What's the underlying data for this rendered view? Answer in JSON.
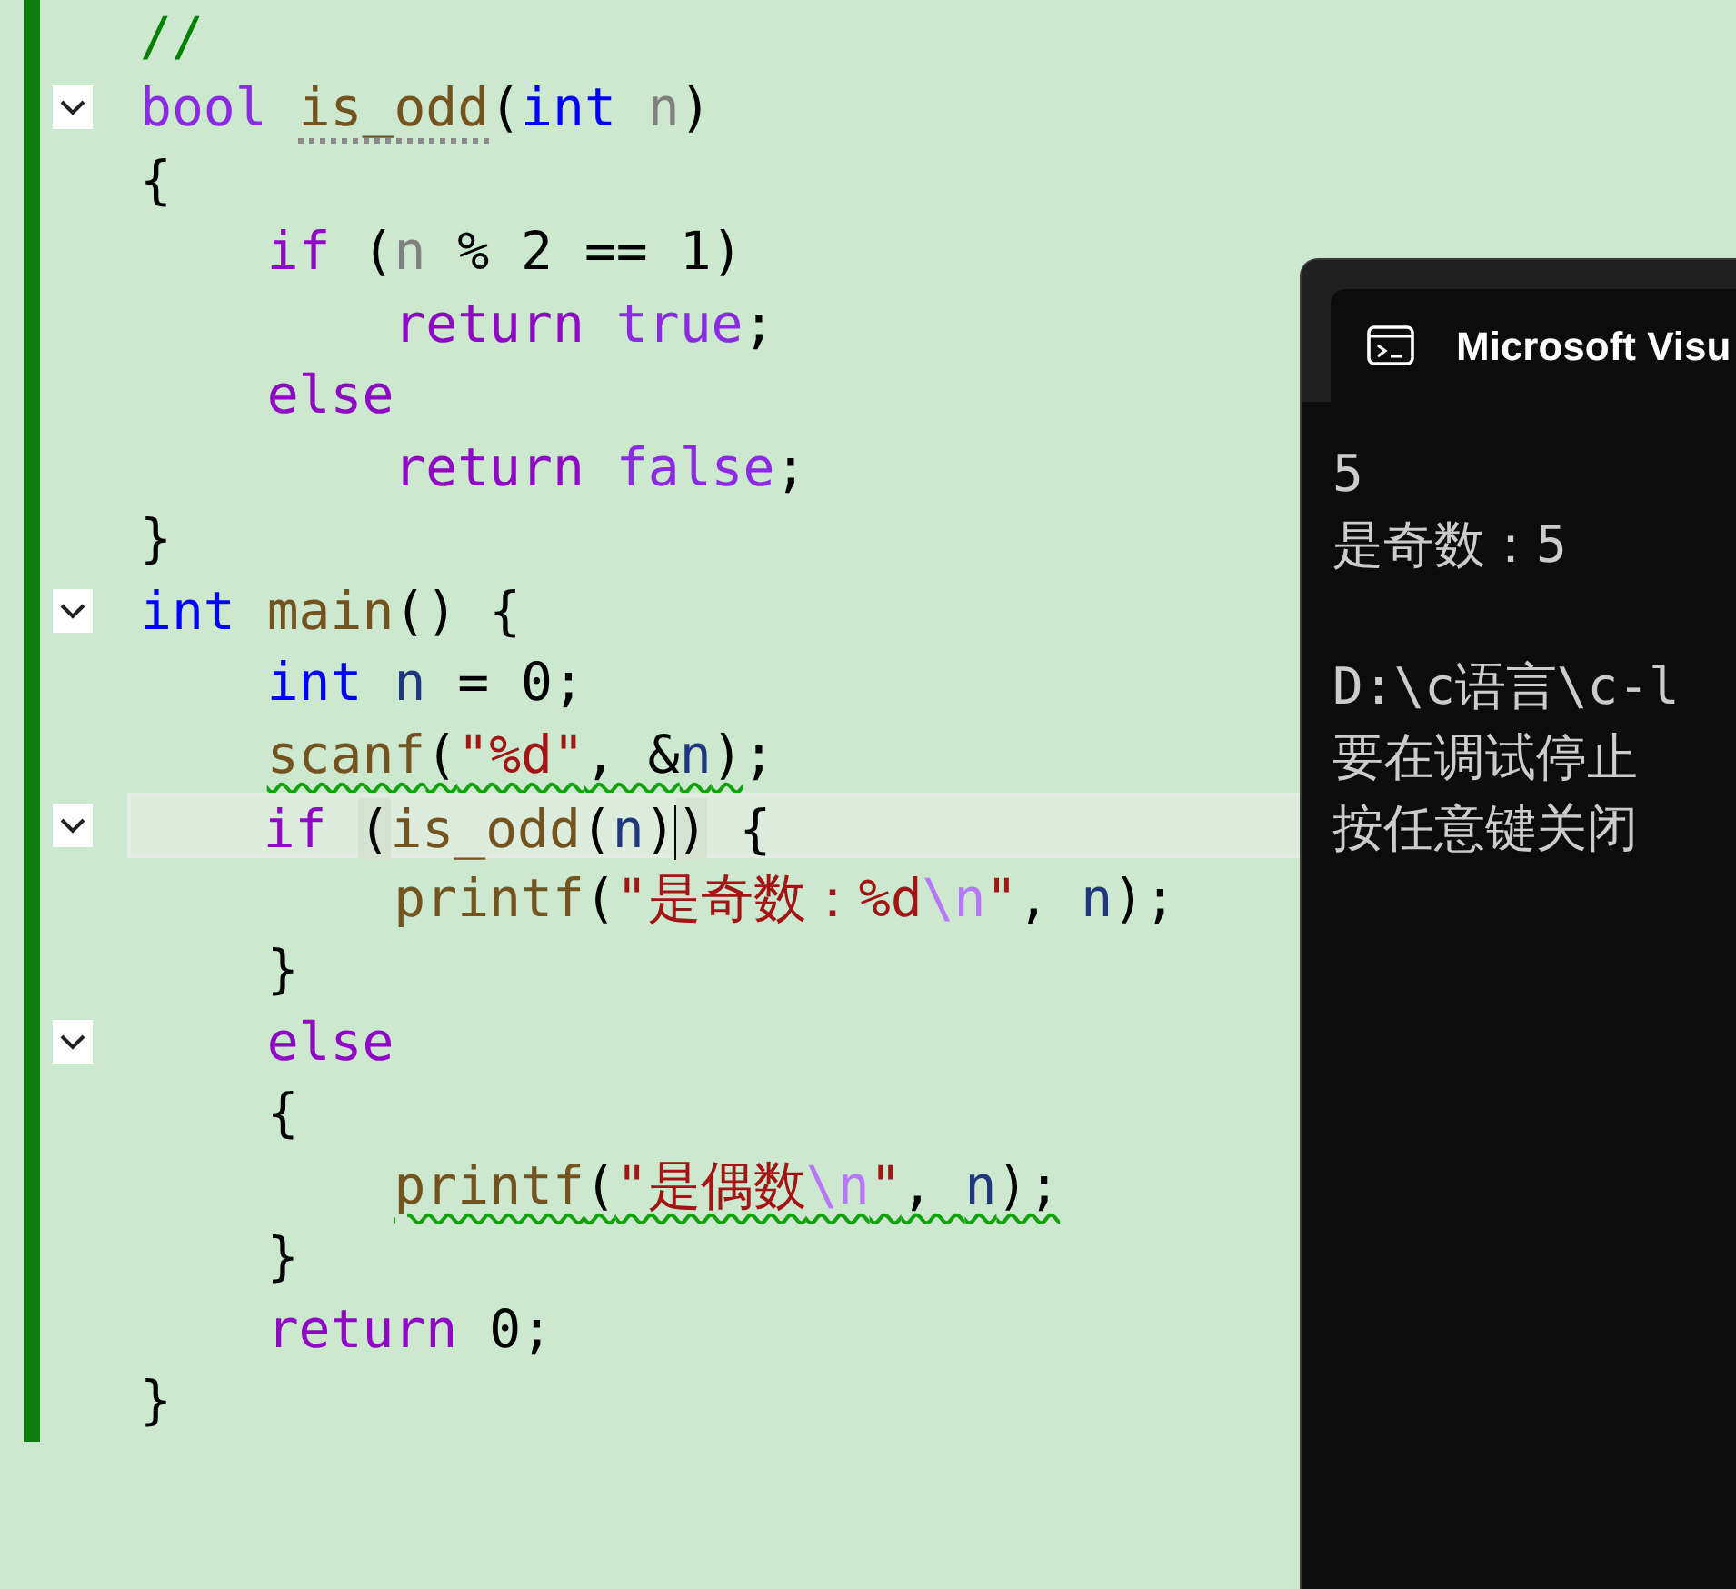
{
  "editor": {
    "lines": [
      {
        "current": false,
        "tokens": [
          {
            "kind": "comment",
            "text": "//"
          }
        ]
      },
      {
        "current": false,
        "expanded": true,
        "tokens": [
          {
            "kind": "keyword",
            "text": "bool "
          },
          {
            "kind": "function",
            "text": "is_odd",
            "hint": true
          },
          {
            "kind": "plain",
            "text": "("
          },
          {
            "kind": "type",
            "text": "int "
          },
          {
            "kind": "param",
            "text": "n"
          },
          {
            "kind": "plain",
            "text": ")"
          }
        ]
      },
      {
        "current": false,
        "tokens": [
          {
            "kind": "plain",
            "text": "{"
          }
        ]
      },
      {
        "current": false,
        "tokens": [
          {
            "kind": "control",
            "text": "    if"
          },
          {
            "kind": "plain",
            "text": " ("
          },
          {
            "kind": "param",
            "text": "n"
          },
          {
            "kind": "plain",
            "text": " % 2 == 1)"
          }
        ]
      },
      {
        "current": false,
        "tokens": [
          {
            "kind": "control",
            "text": "        return "
          },
          {
            "kind": "keyword",
            "text": "true"
          },
          {
            "kind": "plain",
            "text": ";"
          }
        ]
      },
      {
        "current": false,
        "tokens": [
          {
            "kind": "control",
            "text": "    else"
          }
        ]
      },
      {
        "current": false,
        "tokens": [
          {
            "kind": "control",
            "text": "        return "
          },
          {
            "kind": "keyword",
            "text": "false"
          },
          {
            "kind": "plain",
            "text": ";"
          }
        ]
      },
      {
        "current": false,
        "tokens": [
          {
            "kind": "plain",
            "text": "}"
          }
        ]
      },
      {
        "current": false,
        "expanded": true,
        "tokens": [
          {
            "kind": "type",
            "text": "int "
          },
          {
            "kind": "function",
            "text": "main"
          },
          {
            "kind": "plain",
            "text": "() {"
          }
        ]
      },
      {
        "current": false,
        "tokens": [
          {
            "kind": "type",
            "text": "    int "
          },
          {
            "kind": "local",
            "text": "n"
          },
          {
            "kind": "plain",
            "text": " = 0;"
          }
        ]
      },
      {
        "current": false,
        "tokens": [
          {
            "kind": "function",
            "text": "    scanf",
            "squiggle": true
          },
          {
            "kind": "plain",
            "text": "(",
            "squiggle": true
          },
          {
            "kind": "string",
            "text": "\"%d\"",
            "squiggle": true
          },
          {
            "kind": "plain",
            "text": ", &",
            "squiggle": true
          },
          {
            "kind": "local",
            "text": "n",
            "squiggle": true
          },
          {
            "kind": "plain",
            "text": ")",
            "squiggle": true
          },
          {
            "kind": "plain",
            "text": ";"
          }
        ]
      },
      {
        "current": true,
        "expanded": true,
        "tokens": [
          {
            "kind": "control",
            "text": "    if "
          },
          {
            "kind": "plain",
            "text": "(",
            "match": true
          },
          {
            "kind": "function",
            "text": "is_odd"
          },
          {
            "kind": "plain",
            "text": "("
          },
          {
            "kind": "local",
            "text": "n"
          },
          {
            "kind": "plain",
            "text": ")"
          },
          {
            "kind": "caret"
          },
          {
            "kind": "plain",
            "text": ")",
            "match": true
          },
          {
            "kind": "plain",
            "text": " {"
          }
        ]
      },
      {
        "current": false,
        "tokens": [
          {
            "kind": "function",
            "text": "        printf"
          },
          {
            "kind": "plain",
            "text": "("
          },
          {
            "kind": "string",
            "text": "\"是奇数：%d"
          },
          {
            "kind": "escape",
            "text": "\\n"
          },
          {
            "kind": "string",
            "text": "\""
          },
          {
            "kind": "plain",
            "text": ", "
          },
          {
            "kind": "local",
            "text": "n"
          },
          {
            "kind": "plain",
            "text": ");"
          }
        ]
      },
      {
        "current": false,
        "tokens": [
          {
            "kind": "plain",
            "text": "    }"
          }
        ]
      },
      {
        "current": false,
        "expanded": true,
        "tokens": [
          {
            "kind": "control",
            "text": "    else"
          }
        ]
      },
      {
        "current": false,
        "tokens": [
          {
            "kind": "plain",
            "text": "    {"
          }
        ]
      },
      {
        "current": false,
        "tokens": [
          {
            "kind": "function",
            "text": "        printf",
            "squiggle": true
          },
          {
            "kind": "plain",
            "text": "(",
            "squiggle": true
          },
          {
            "kind": "string",
            "text": "\"是偶数",
            "squiggle": true
          },
          {
            "kind": "escape",
            "text": "\\n",
            "squiggle": true
          },
          {
            "kind": "string",
            "text": "\"",
            "squiggle": true
          },
          {
            "kind": "plain",
            "text": ", ",
            "squiggle": true
          },
          {
            "kind": "local",
            "text": "n",
            "squiggle": true
          },
          {
            "kind": "plain",
            "text": ");",
            "squiggle": true
          }
        ]
      },
      {
        "current": false,
        "tokens": [
          {
            "kind": "plain",
            "text": "    }"
          }
        ]
      },
      {
        "current": false,
        "tokens": [
          {
            "kind": "control",
            "text": "    return"
          },
          {
            "kind": "plain",
            "text": " 0;"
          }
        ]
      },
      {
        "current": false,
        "tokens": [
          {
            "kind": "plain",
            "text": "}"
          }
        ]
      }
    ]
  },
  "console": {
    "title": "Microsoft Visu",
    "blocks": [
      [
        "5",
        "是奇数：5"
      ],
      [
        "D:\\c语言\\c-l",
        "要在调试停止",
        "按任意键关闭"
      ]
    ]
  }
}
